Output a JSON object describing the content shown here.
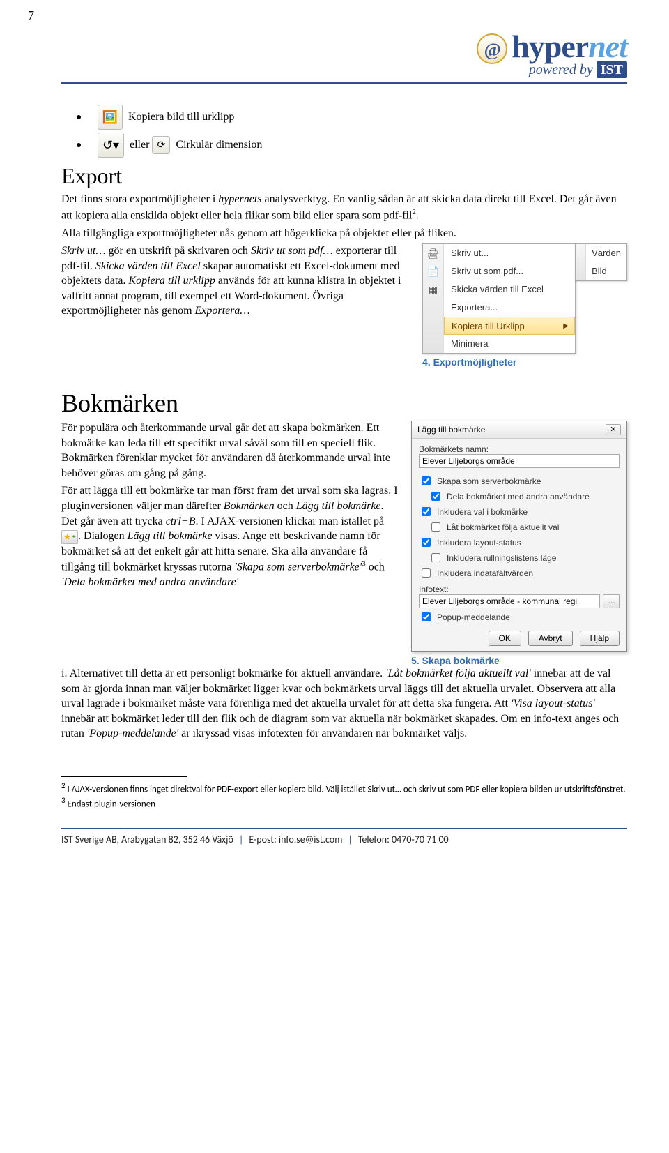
{
  "page_number": "7",
  "logo": {
    "hyper": "hyper",
    "net": "net",
    "powered": "powered by",
    "ist": "IST"
  },
  "bullets": {
    "item1": "Kopiera bild till urklipp",
    "item2_mid": "eller",
    "item2_end": "Cirkulär dimension"
  },
  "export": {
    "heading": "Export",
    "p1a": "Det finns stora exportmöjligheter i ",
    "p1b": "hypernets",
    "p1c": " analysverktyg. En vanlig sådan är att skicka data direkt till Excel. Det går även att kopiera alla enskilda objekt eller hela flikar som bild eller spara som pdf-fil",
    "p1sup": "2",
    "p1d": ".",
    "p2": "Alla tillgängliga exportmöjligheter nås genom att högerklicka på objektet eller på fliken.",
    "p3a": "Skriv ut…",
    "p3b": " gör en utskrift på skrivaren och ",
    "p3c": "Skriv ut som pdf…",
    "p3d": " exporterar till pdf-fil. ",
    "p3e": "Skicka värden till Excel",
    "p3f": " skapar automatiskt ett Excel-dokument med objektets data. ",
    "p3g": "Kopiera till urklipp",
    "p3h": " används för att kunna klistra in objektet i valfritt annat program, till exempel ett Word-dokument. Övriga exportmöjligheter nås genom ",
    "p3i": "Exportera…"
  },
  "menu": {
    "items": [
      "Skriv ut...",
      "Skriv ut som pdf...",
      "Skicka värden till Excel",
      "Exportera...",
      "Kopiera till Urklipp",
      "Minimera"
    ],
    "submenu": [
      "Värden",
      "Bild"
    ],
    "caption": "4. Exportmöjligheter"
  },
  "bookmarks": {
    "heading": "Bokmärken",
    "p1": "För populära och återkommande urval går det att skapa bokmärken. Ett bokmärke kan leda till ett specifikt urval såväl som till en speciell flik. Bokmärken förenklar mycket för användaren då återkommande urval inte behöver göras om gång på gång.",
    "p2a": "För att lägga till ett bokmärke tar man först fram det urval som ska lagras. I pluginversionen väljer man därefter ",
    "p2b": "Bokmärken",
    "p2c": " och ",
    "p2d": "Lägg till bokmärke",
    "p2e": ". Det går även att trycka ",
    "p2f": "ctrl+B",
    "p2g": ". I AJAX-versionen klickar man istället på ",
    "p2h": ". Dialogen ",
    "p2i": "Lägg till bokmärke",
    "p2j": " visas. Ange ett beskrivande namn för bokmärket så att det enkelt går att hitta senare. Ska alla användare få tillgång till bokmärket kryssas rutorna ",
    "p2k": "'Skapa som serverbokmärke'",
    "p2sup": "3",
    "p2l": " och ",
    "p2m": "'Dela bokmärket med andra användare'",
    "p2n": " i. Alternativet till detta är ett personligt bokmärke för aktuell användare. ",
    "p2o": "'Låt bokmärket följa aktuellt val'",
    "p2p": " innebär att de val som är gjorda innan man väljer bokmärket ligger kvar och bokmärkets urval läggs till det aktuella urvalet. Observera att alla urval lagrade i bokmärket måste vara förenliga med det aktuella urvalet för att detta ska fungera. Att ",
    "p2q": "'Visa layout-status'",
    "p2r": " innebär att bokmärket leder till den flik och de diagram som var aktuella när bokmärket skapades. Om en info-text anges och rutan ",
    "p2s": "'Popup-meddelande'",
    "p2t": " är ikryssad visas infotexten för användaren när bokmärket väljs."
  },
  "dialog": {
    "title": "Lägg till bokmärke",
    "name_label": "Bokmärkets namn:",
    "name_value": "Elever Liljeborgs område",
    "chk1": "Skapa som serverbokmärke",
    "chk2": "Dela bokmärket med andra användare",
    "chk3": "Inkludera val i bokmärke",
    "chk4": "Låt bokmärket följa aktuellt val",
    "chk5": "Inkludera layout-status",
    "chk6": "Inkludera rullningslistens läge",
    "chk7": "Inkludera indatafältvärden",
    "info_label": "Infotext:",
    "info_value": "Elever Liljeborgs område - kommunal regi",
    "chk8": "Popup-meddelande",
    "ok": "OK",
    "cancel": "Avbryt",
    "help": "Hjälp",
    "caption": "5. Skapa bokmärke"
  },
  "footnotes": {
    "f2": "I AJAX-versionen finns inget direktval för PDF-export eller kopiera bild. Välj istället Skriv ut… och skriv ut som PDF eller kopiera bilden ur utskriftsfönstret.",
    "f3": "Endast plugin-versionen"
  },
  "footer": {
    "a": "IST Sverige AB, Arabygatan 82, 352 46 Växjö",
    "b": "E-post: info.se@ist.com",
    "c": "Telefon: 0470-70 71 00"
  }
}
